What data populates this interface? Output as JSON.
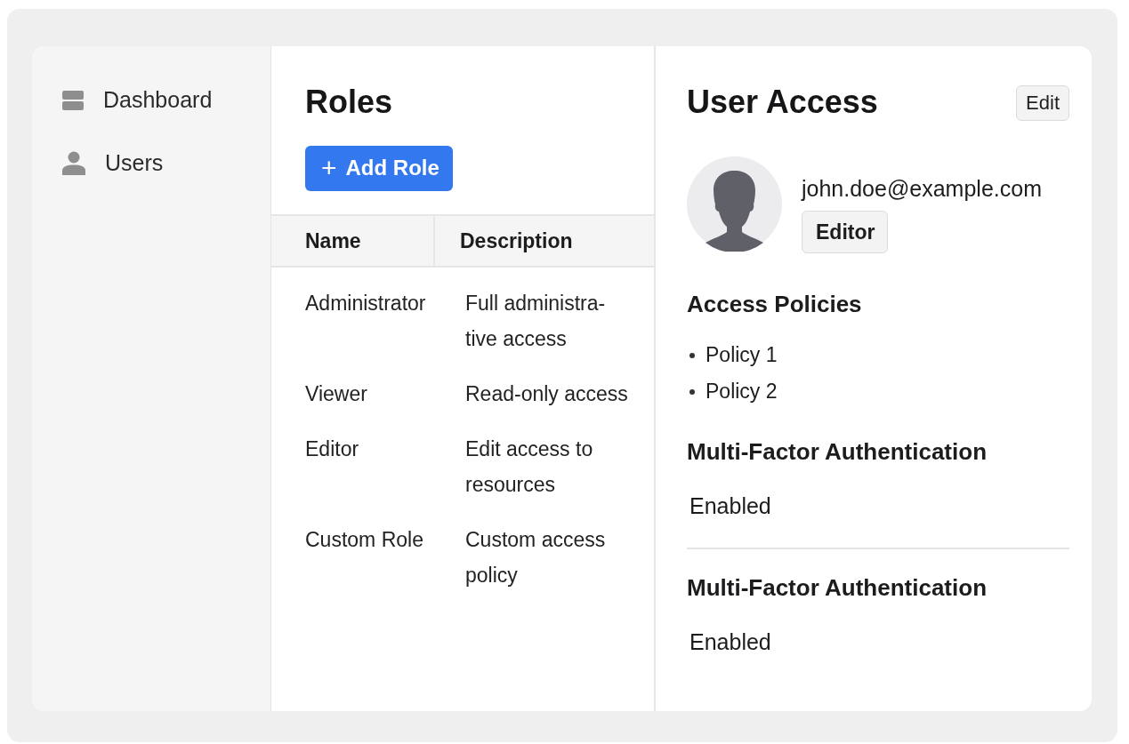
{
  "sidebar": {
    "items": [
      {
        "label": "Dashboard",
        "kind": "dashboard"
      },
      {
        "label": "Users",
        "kind": "user"
      }
    ]
  },
  "roles": {
    "title": "Roles",
    "add_button": {
      "icon": "+",
      "label": "Add Role"
    },
    "table": {
      "columns": [
        "Name",
        "Description"
      ],
      "rows": [
        {
          "name": "Administrator",
          "description": "Full administra-tive access"
        },
        {
          "name": "Viewer",
          "description": "Read-only access"
        },
        {
          "name": "Editor",
          "description": "Edit access to resources"
        },
        {
          "name": "Custom Role",
          "description": "Custom access policy"
        }
      ]
    }
  },
  "user_access": {
    "title": "User Access",
    "edit_button": "Edit",
    "email": "john.doe@example.com",
    "role_badge": "Editor",
    "sections": [
      {
        "kind": "list",
        "title": "Access Policies",
        "divider_before": false,
        "items": [
          "Policy 1",
          "Policy 2"
        ]
      },
      {
        "kind": "text",
        "title": "Multi-Factor Authentication",
        "divider_before": false,
        "value": "Enabled"
      },
      {
        "kind": "text",
        "title": "Multi-Factor Authentication",
        "divider_before": true,
        "value": "Enabled"
      }
    ]
  }
}
